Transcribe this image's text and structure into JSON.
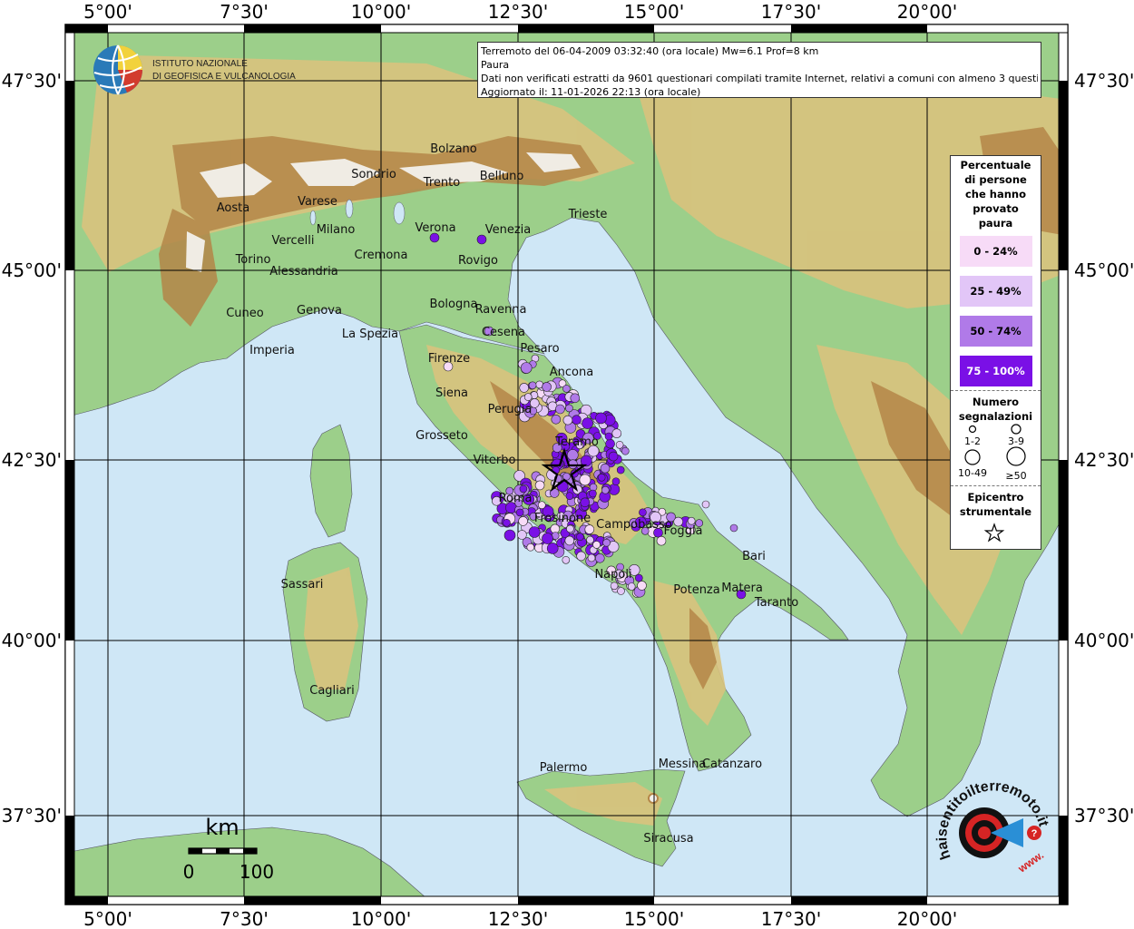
{
  "colors": {
    "sea": "#cfe7f6",
    "lowland": "#9ccf8a",
    "hill": "#d9c27d",
    "mountain": "#b48648",
    "snow": "#f3f1ec",
    "class_0_24": "#f7dbf7",
    "class_25_49": "#e2c6f7",
    "class_50_74": "#b07ae8",
    "class_75_100": "#7a10e6"
  },
  "header": {
    "line1": "Terremoto del 06-04-2009 03:32:40 (ora locale) Mw=6.1 Prof=8 km",
    "line2": "Paura",
    "line3": "Dati non verificati estratti da 9601 questionari compilati tramite Internet, relativi a comuni con almeno 3 questionari.",
    "line4": "Aggiornato il: 11-01-2026 22:13 (ora locale)"
  },
  "logo": {
    "org_line1": "ISTITUTO NAZIONALE",
    "org_line2": "DI GEOFISICA E VULCANOLOGIA",
    "site_main": "haisentitoilterremoto.it",
    "site_www": "www."
  },
  "axes": {
    "lon_labels": [
      "5°00'",
      "7°30'",
      "10°00'",
      "12°30'",
      "15°00'",
      "17°30'",
      "20°00'"
    ],
    "lat_labels": [
      "47°30'",
      "45°00'",
      "42°30'",
      "40°00'",
      "37°30'"
    ]
  },
  "legend": {
    "title_lines": [
      "Percentuale",
      "di persone",
      "che hanno",
      "provato",
      "paura"
    ],
    "classes": [
      "0 - 24%",
      "25 - 49%",
      "50 - 74%",
      "75 - 100%"
    ],
    "count_title_lines": [
      "Numero",
      "segnalazioni"
    ],
    "counts": [
      "1-2",
      "3-9",
      "10-49",
      "≥50"
    ],
    "epicenter_lines": [
      "Epicentro",
      "strumentale"
    ]
  },
  "scale": {
    "unit": "km",
    "min": "0",
    "max": "100"
  },
  "cities": [
    "Bolzano",
    "Sondrio",
    "Trento",
    "Belluno",
    "Aosta",
    "Varese",
    "Trieste",
    "Milano",
    "Verona",
    "Venezia",
    "Vercelli",
    "Cremona",
    "Rovigo",
    "Torino",
    "Alessandria",
    "Bologna",
    "Cuneo",
    "Genova",
    "Ravenna",
    "La Spezia",
    "Cesena",
    "Imperia",
    "Pesaro",
    "Firenze",
    "Ancona",
    "Siena",
    "Perugia",
    "Grosseto",
    "Teramo",
    "Viterbo",
    "Roma",
    "Frosinone",
    "Campobasso",
    "Foggia",
    "Bari",
    "Sassari",
    "Napoli",
    "Potenza",
    "Matera",
    "Taranto",
    "Cagliari",
    "Catanzaro",
    "Palermo",
    "Messina",
    "Siracusa"
  ]
}
